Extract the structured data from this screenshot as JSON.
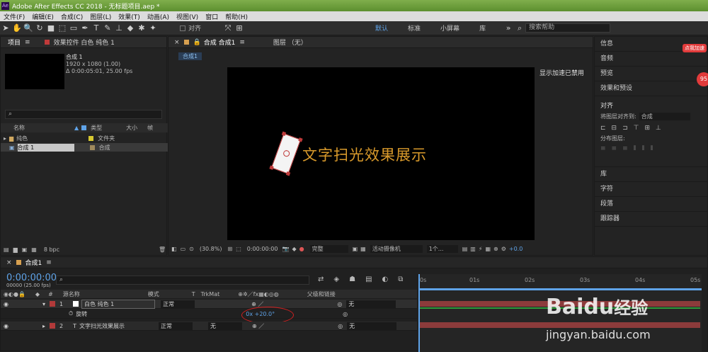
{
  "window": {
    "title": "Adobe After Effects CC 2018 - 无标题项目.aep *",
    "logo": "Ae"
  },
  "menu": [
    "文件(F)",
    "编辑(E)",
    "合成(C)",
    "图层(L)",
    "效果(T)",
    "动画(A)",
    "视图(V)",
    "窗口",
    "帮助(H)"
  ],
  "toolbar": {
    "align_label": "对齐",
    "workspaces": [
      "默认",
      "标准",
      "小屏幕",
      "库"
    ],
    "search_placeholder": "搜索帮助"
  },
  "project": {
    "tab": "项目",
    "effects_tab": "效果控件 白色 纯色 1",
    "comp_name": "合成 1",
    "comp_info1": "1920 x 1080 (1.00)",
    "comp_info2": "Δ 0:00:05:01, 25.00 fps",
    "search_placeholder": "",
    "columns": [
      "名称",
      "类型",
      "大小",
      "帧"
    ],
    "items": [
      {
        "name": "纯色",
        "type": "文件夹"
      },
      {
        "name": "合成 1",
        "type": "合成"
      }
    ],
    "bpc": "8 bpc"
  },
  "comp": {
    "tab": "合成 合成1",
    "layer_tab": "图层 （无）",
    "sub_tab": "合成1",
    "accel_msg": "显示加速已禁用",
    "text": "文字扫光效果展示"
  },
  "viewer": {
    "zoom": "(30.8%)",
    "time": "0:00:00:00",
    "quality": "完整",
    "camera": "活动摄像机",
    "views": "1个...",
    "exposure": "+0.0"
  },
  "right": {
    "items": [
      "信息",
      "音频",
      "预览",
      "效果和预设"
    ],
    "align_title": "对齐",
    "align_to_label": "将图层对齐到:",
    "align_to_value": "合成",
    "distribute_label": "分布图层:",
    "items2": [
      "库",
      "字符",
      "段落",
      "跟踪器"
    ],
    "badge": "95",
    "help_tag": "点我加速"
  },
  "timeline": {
    "tab": "合成1",
    "timecode": "0:00:00:00",
    "fps": "00000 (25.00 fps)",
    "cols": {
      "source": "源名称",
      "mode": "模式",
      "t": "T",
      "trkmat": "TrkMat",
      "parent": "父级和链接"
    },
    "layers": [
      {
        "num": "1",
        "name": "白色 纯色 1",
        "mode": "正常",
        "parent": "无",
        "color": "#c8c8c8"
      },
      {
        "num": "2",
        "name": "文字扫光效果展示",
        "mode": "正常",
        "trk": "无",
        "parent": "无",
        "color": "#c8c8c8"
      }
    ],
    "rotation_label": "旋转",
    "rotation_value": "0x +20.0°",
    "ruler": [
      "0s",
      "01s",
      "02s",
      "03s",
      "04s",
      "05s"
    ]
  },
  "watermark": {
    "brand": "Bai",
    "brand2": "经验",
    "url": "jingyan.baidu.com"
  },
  "colors": {
    "accent": "#3c8fd9",
    "layer_label": "#b23a3a",
    "text": "#d99a2b"
  }
}
